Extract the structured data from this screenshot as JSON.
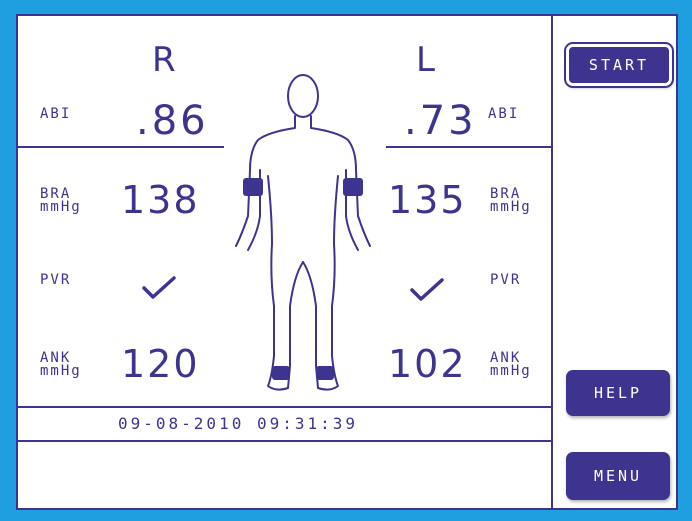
{
  "headers": {
    "right": "R",
    "left": "L"
  },
  "right": {
    "abi_label": "ABI",
    "abi_value": ".86",
    "bra_label_1": "BRA",
    "bra_label_2": "mmHg",
    "bra_value": "138",
    "pvr_label": "PVR",
    "ank_label_1": "ANK",
    "ank_label_2": "mmHg",
    "ank_value": "120"
  },
  "left": {
    "abi_label": "ABI",
    "abi_value": ".73",
    "bra_label_1": "BRA",
    "bra_label_2": "mmHg",
    "bra_value": "135",
    "pvr_label": "PVR",
    "ank_label_1": "ANK",
    "ank_label_2": "mmHg",
    "ank_value": "102"
  },
  "datetime": "09-08-2010 09:31:39",
  "buttons": {
    "start": "START",
    "help": "HELP",
    "menu": "MENU"
  },
  "icons": {
    "pvr_status": "checkmark-icon",
    "figure": "body-figure-icon"
  },
  "colors": {
    "frame_bg": "#1f9fe0",
    "ink": "#3d3490",
    "screen": "#ffffff"
  }
}
